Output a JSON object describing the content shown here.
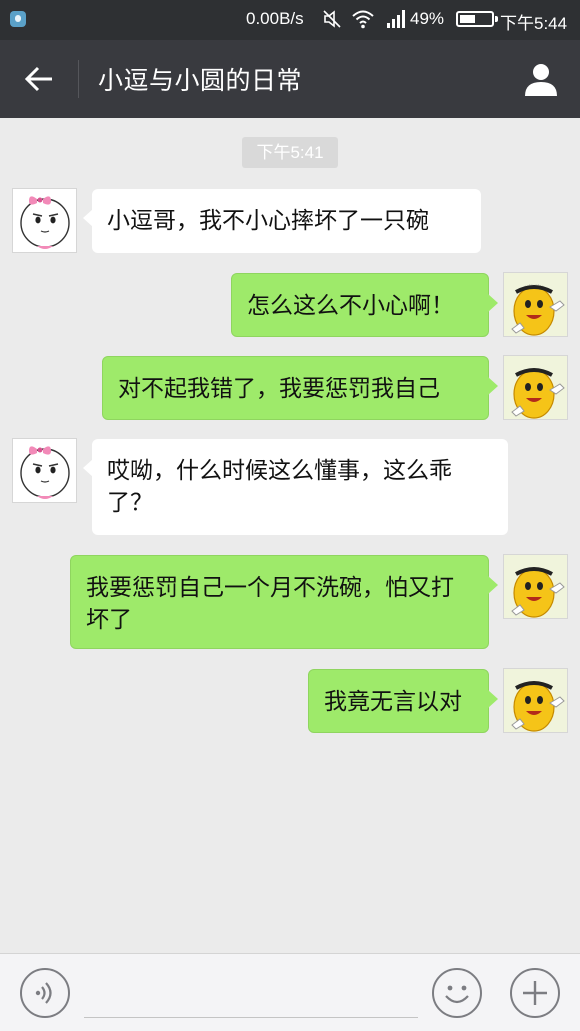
{
  "status_bar": {
    "net_speed": "0.00B/s",
    "battery_percent": "49%",
    "battery_level": 0.49,
    "time": "下午5:44"
  },
  "header": {
    "title": "小逗与小圆的日常",
    "back_icon": "arrow-left-icon",
    "profile_icon": "person-icon"
  },
  "chat": {
    "timestamp": "下午5:41",
    "messages": [
      {
        "side": "in",
        "text": "小逗哥，我不小心摔坏了一只碗"
      },
      {
        "side": "out",
        "text": "怎么这么不小心啊！"
      },
      {
        "side": "out",
        "text": "对不起我错了，我要惩罚我自己"
      },
      {
        "side": "in",
        "text": "哎呦，什么时候这么懂事，这么乖了？"
      },
      {
        "side": "out",
        "text": "我要惩罚自己一个月不洗碗，怕又打坏了"
      },
      {
        "side": "out",
        "text": "我竟无言以对"
      }
    ]
  },
  "input_bar": {
    "voice_icon": "voice-icon",
    "emoji_icon": "emoji-icon",
    "plus_icon": "plus-icon"
  },
  "colors": {
    "header_bg": "#393a3f",
    "status_bg": "#2e3033",
    "chat_bg": "#ebebeb",
    "outgoing_bubble": "#9eea6a",
    "incoming_bubble": "#ffffff"
  }
}
